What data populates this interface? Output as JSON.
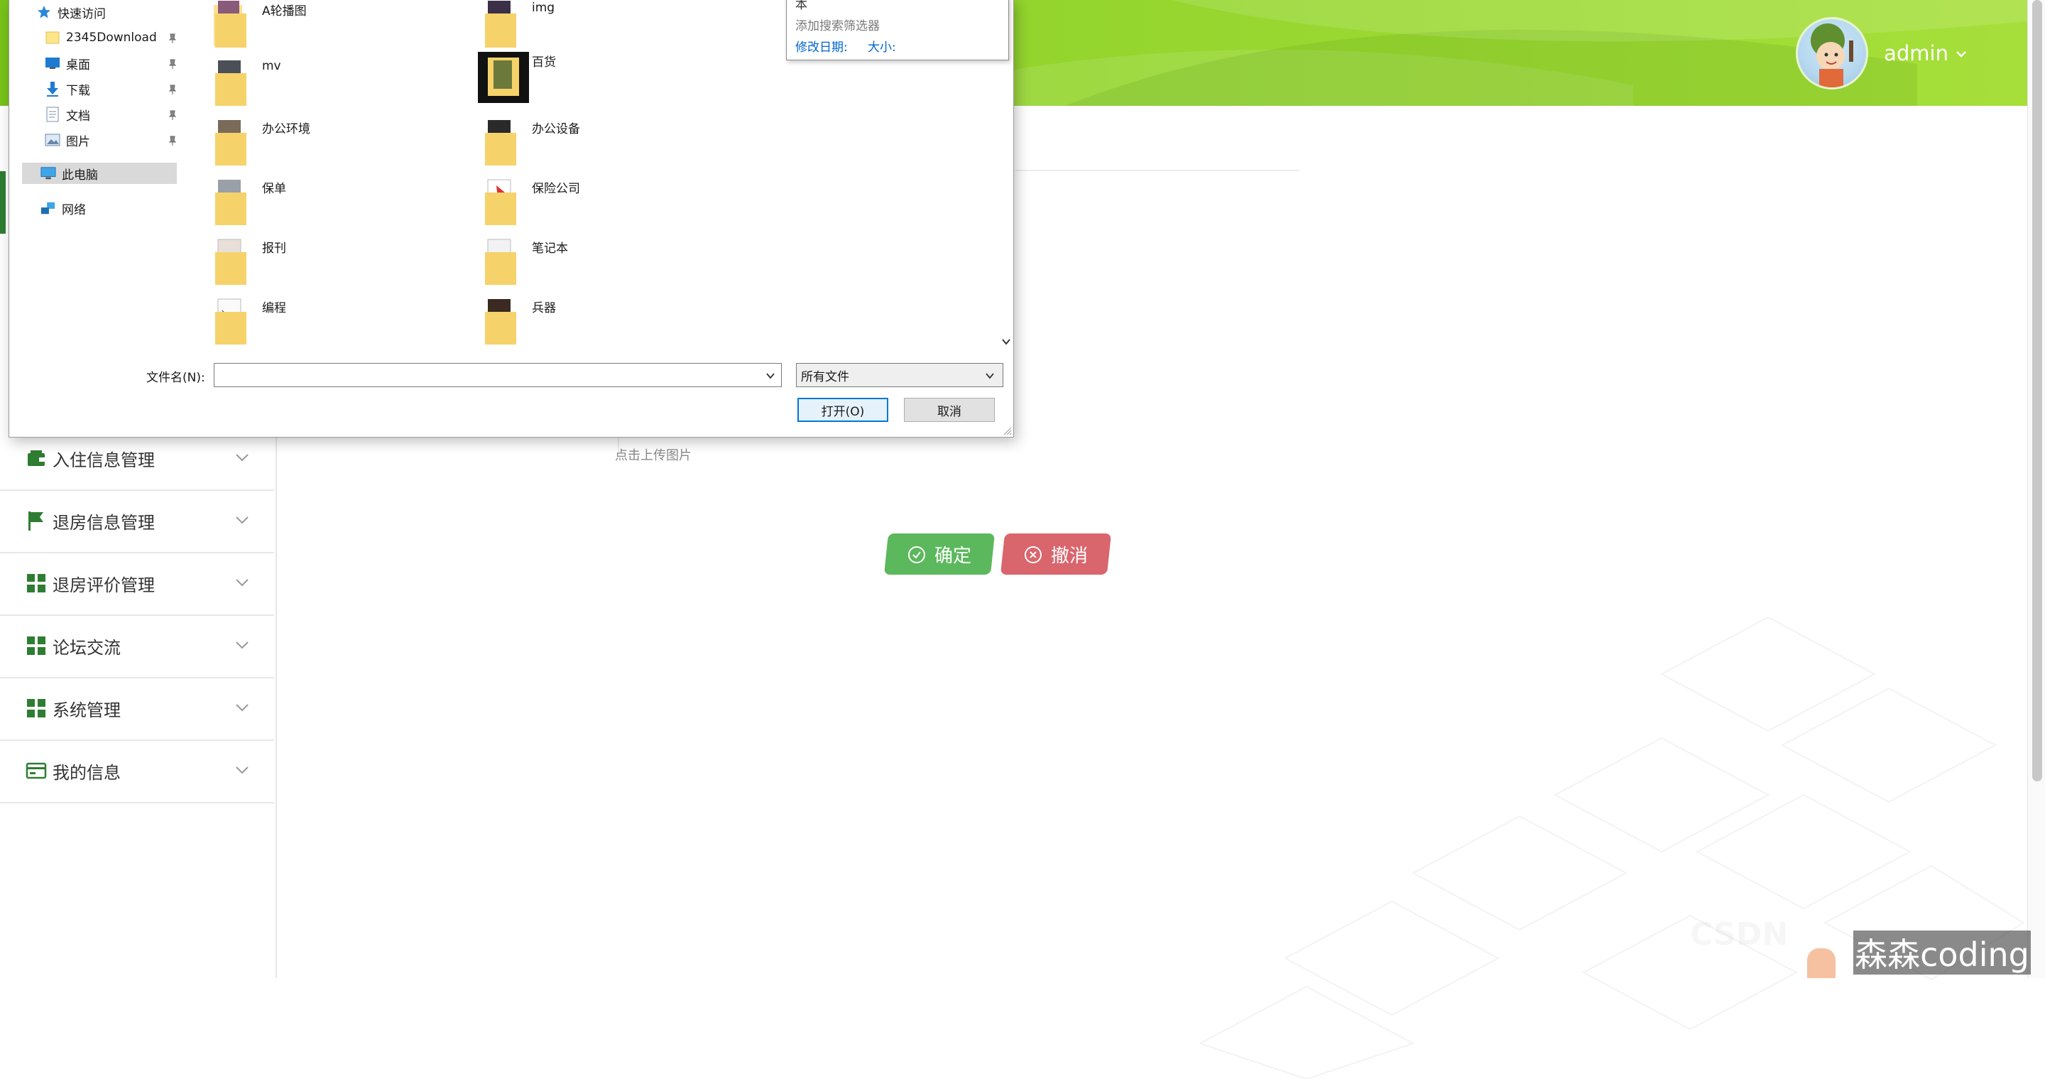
{
  "header": {
    "username": "admin"
  },
  "sidebar": {
    "items": [
      {
        "label": "入住信息管理",
        "icon": "wallet-icon"
      },
      {
        "label": "退房信息管理",
        "icon": "flag-icon"
      },
      {
        "label": "退房评价管理",
        "icon": "grid-icon"
      },
      {
        "label": "论坛交流",
        "icon": "grid-icon"
      },
      {
        "label": "系统管理",
        "icon": "grid-icon"
      },
      {
        "label": "我的信息",
        "icon": "card-icon"
      }
    ]
  },
  "form": {
    "upload_hint": "点击上传图片",
    "confirm_label": "确定",
    "cancel_label": "撤消"
  },
  "file_dialog": {
    "nav": {
      "quick_access": "快速访问",
      "pinned": [
        "2345Download",
        "桌面",
        "下载",
        "文档",
        "图片"
      ],
      "this_pc": "此电脑",
      "network": "网络"
    },
    "files": [
      "A轮播图",
      "img",
      "mv",
      "百货",
      "办公环境",
      "办公设备",
      "保单",
      "保险公司",
      "报刊",
      "笔记本",
      "编程",
      "兵器"
    ],
    "search_filter": {
      "cut_text": "本",
      "title": "添加搜索筛选器",
      "modified_date": "修改日期:",
      "size": "大小:"
    },
    "filename_label": "文件名(N):",
    "filename_value": "",
    "filetype_value": "所有文件",
    "open_label": "打开(O)",
    "cancel_label": "取消"
  },
  "watermark": "森森coding",
  "colors": {
    "header_green": "#8fd22a",
    "menu_icon_green": "#2e7d32",
    "confirm_green": "#5cb85c",
    "cancel_red": "#d9656d"
  }
}
